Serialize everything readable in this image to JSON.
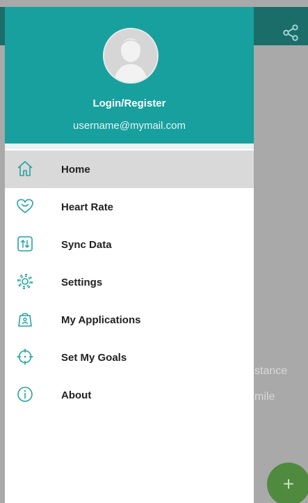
{
  "colors": {
    "header": "#17a09e",
    "icon": "#22a4a2",
    "active_item": "#d9d9d9",
    "background_topbar": "#1b6d6a",
    "fab": "#4f8a3e"
  },
  "drawer": {
    "login_label": "Login/Register",
    "email": "username@mymail.com",
    "items": [
      {
        "label": "Home",
        "icon": "home-icon",
        "active": true
      },
      {
        "label": "Heart Rate",
        "icon": "heart-icon",
        "active": false
      },
      {
        "label": "Sync Data",
        "icon": "sync-icon",
        "active": false
      },
      {
        "label": "Settings",
        "icon": "gear-icon",
        "active": false
      },
      {
        "label": "My Applications",
        "icon": "app-bag-icon",
        "active": false
      },
      {
        "label": "Set My Goals",
        "icon": "target-icon",
        "active": false
      },
      {
        "label": "About",
        "icon": "info-icon",
        "active": false
      }
    ]
  },
  "background": {
    "partial_text_1": "stance",
    "partial_text_2": "mile",
    "fab_label": "+"
  }
}
